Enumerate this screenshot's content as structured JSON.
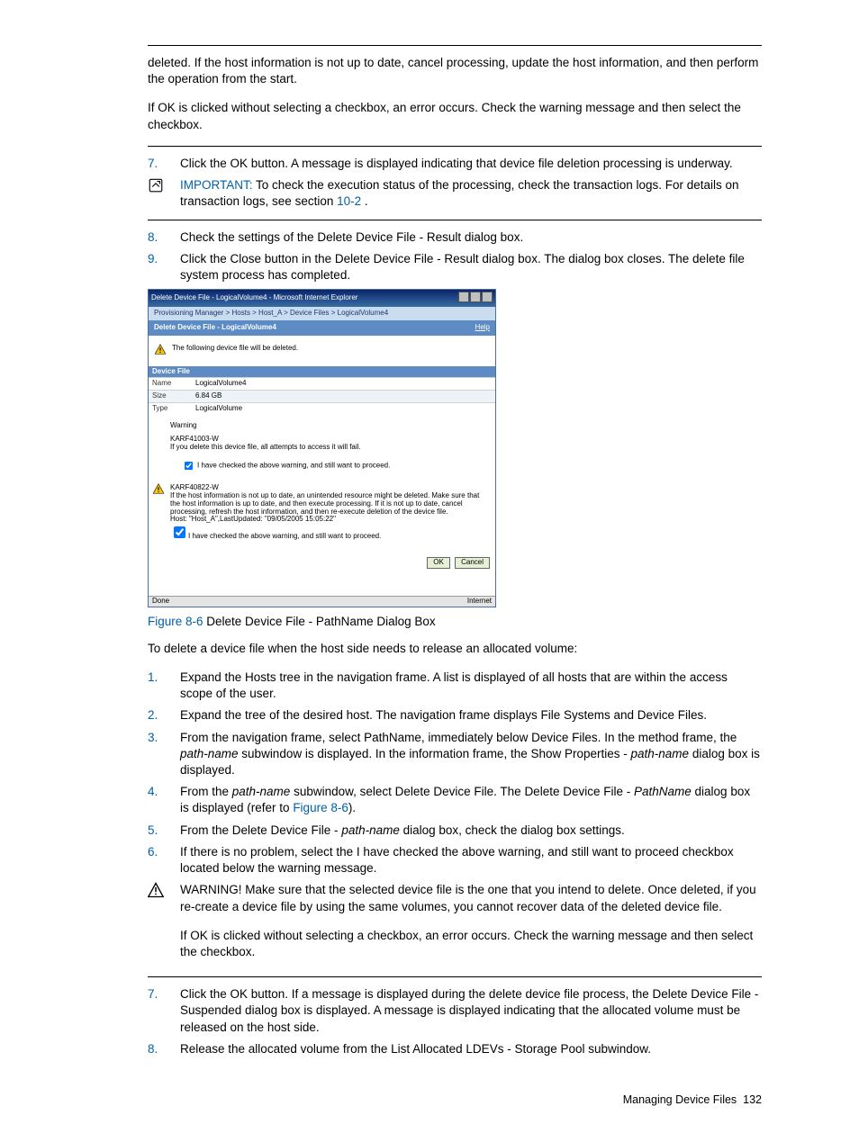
{
  "topParagraphs": {
    "p1": "deleted. If the host information is not up to date, cancel processing, update the host information, and then perform the operation from the start.",
    "p2": "If OK is clicked without selecting a checkbox, an error occurs. Check the warning message and then select the checkbox."
  },
  "list1": {
    "i7": {
      "num": "7.",
      "text": "Click the OK button. A message is displayed indicating that device file deletion processing is underway."
    },
    "imp": {
      "label": "IMPORTANT:",
      "text": "  To check the execution status of the processing, check the transaction logs. For details on transaction logs, see section ",
      "link": "10-2",
      "tail": " ."
    },
    "i8": {
      "num": "8.",
      "text": "Check the settings of the Delete Device File - Result dialog box."
    },
    "i9": {
      "num": "9.",
      "text": "Click the Close button in the Delete Device File - Result dialog box. The dialog box closes. The delete file system process has completed."
    }
  },
  "mock": {
    "title": "Delete Device File - LogicalVolume4 - Microsoft Internet Explorer",
    "crumb": "Provisioning Manager > Hosts > Host_A > Device Files > LogicalVolume4",
    "headerTitle": "Delete Device File - LogicalVolume4",
    "help": "Help",
    "infoText": "The following device file will be deleted.",
    "sectionHdr": "Device File",
    "rows": {
      "nameK": "Name",
      "nameV": "LogicalVolume4",
      "sizeK": "Size",
      "sizeV": "6.84 GB",
      "typeK": "Type",
      "typeV": "LogicalVolume"
    },
    "warn1": {
      "title": "Warning",
      "code": "KARF41003-W",
      "msg": "If you delete this device file, all attempts to access it will fail.",
      "chk": "I have checked the above warning, and still want to proceed."
    },
    "warn2": {
      "code": "KARF40822-W",
      "msg": "If the host information is not up to date, an unintended resource might be deleted. Make sure that the host information is up to date, and then execute processing. If it is not up to date, cancel processing, refresh the host information, and then re-execute deletion of the device file.\nHost: \"Host_A\",LastUpdated: \"09/05/2005 15:05:22\"",
      "chk": "I have checked the above warning, and still want to proceed."
    },
    "okBtn": "OK",
    "cancelBtn": "Cancel",
    "statusL": "Done",
    "statusR": "Internet"
  },
  "caption": {
    "ref": "Figure 8-6",
    "text": " Delete Device File - PathName Dialog Box"
  },
  "midPara": "To delete a device file when the host side needs to release an allocated volume:",
  "list2": {
    "i1": {
      "num": "1.",
      "text": "Expand the Hosts tree in the navigation frame. A list is displayed of all hosts that are within the access scope of the user."
    },
    "i2": {
      "num": "2.",
      "text": "Expand the tree of the desired host. The navigation frame displays File Systems and Device Files."
    },
    "i3": {
      "num": "3.",
      "a": "From the navigation frame, select PathName, immediately below Device Files. In the method frame, the ",
      "b": "path-name",
      "c": " subwindow is displayed. In the information frame, the Show Properties - ",
      "d": "path-name",
      "e": " dialog box is displayed."
    },
    "i4": {
      "num": "4.",
      "a": "From the ",
      "b": "path-name",
      "c": " subwindow, select Delete Device File. The Delete Device File - ",
      "d": "PathName",
      "e": " dialog box is displayed (refer to ",
      "link": "Figure 8-6",
      "f": ")."
    },
    "i5": {
      "num": "5.",
      "a": "From the Delete Device File - ",
      "b": "path-name",
      "c": " dialog box, check the dialog box settings."
    },
    "i6": {
      "num": "6.",
      "text": "If there is no problem, select the I have checked the above warning, and still want to proceed checkbox located below the warning message."
    },
    "warn": {
      "label": "WARNING!",
      "p1": "  Make sure that the selected device file is the one that you intend to delete. Once deleted, if you re-create a device file by using the same volumes, you cannot recover data of the deleted device file.",
      "p2": "If OK is clicked without selecting a checkbox, an error occurs. Check the warning message and then select the checkbox."
    },
    "i7": {
      "num": "7.",
      "text": "Click the OK button. If a message is displayed during the delete device file process, the Delete Device File - Suspended dialog box is displayed. A message is displayed indicating that the allocated volume must be released on the host side."
    },
    "i8": {
      "num": "8.",
      "text": "Release the allocated volume from the List Allocated LDEVs - Storage Pool subwindow."
    }
  },
  "footer": {
    "text": "Managing Device Files",
    "page": "132"
  }
}
